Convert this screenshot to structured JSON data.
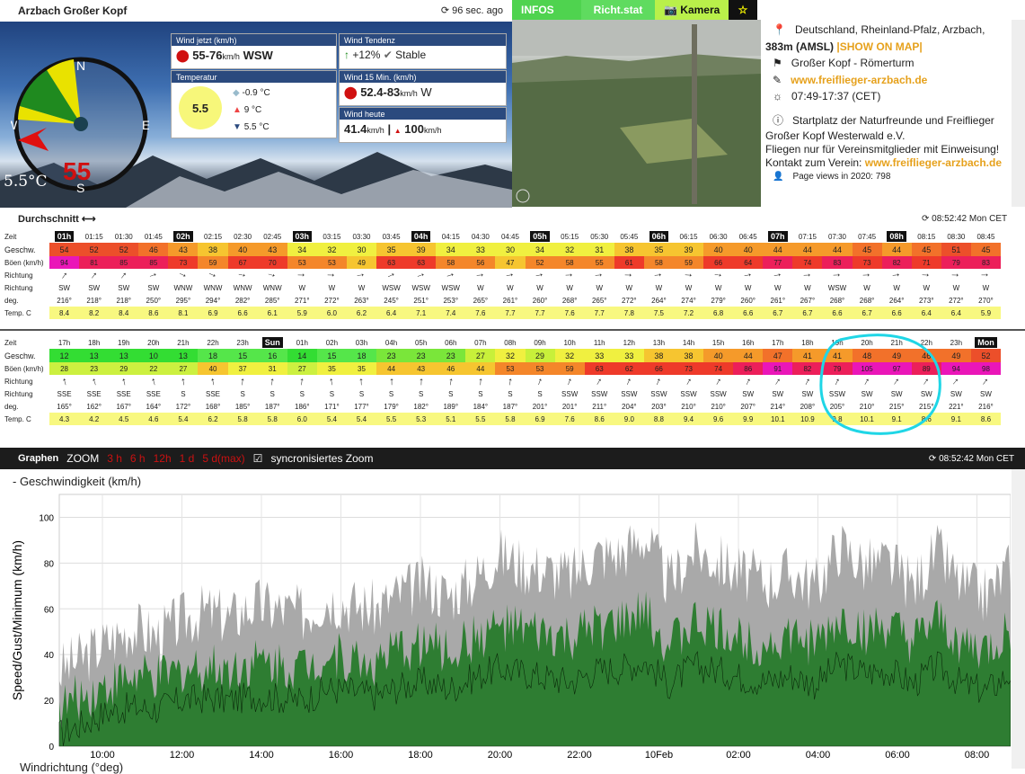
{
  "station": {
    "title": "Arzbach Großer Kopf",
    "updated": "96 sec. ago"
  },
  "tabs": [
    "INFOS",
    "Richt.stat",
    "Kamera"
  ],
  "compass": {
    "speed": "55",
    "temp": "5.5°C",
    "N": "N",
    "S": "S",
    "E": "E",
    "W": "W"
  },
  "cards": {
    "wind_now": {
      "title": "Wind jetzt (km/h)",
      "range": "55-76",
      "unit": "km/h",
      "dir": "WSW"
    },
    "trend": {
      "title": "Wind Tendenz",
      "delta": "+12%",
      "state": "Stable"
    },
    "temp": {
      "title": "Temperatur",
      "value": "5.5",
      "min": "-0.9 °C",
      "max": "9 °C",
      "cur": "5.5 °C"
    },
    "wind15": {
      "title": "Wind 15 Min. (km/h)",
      "range": "52.4-83",
      "unit": "km/h",
      "dir": "W"
    },
    "today": {
      "title": "Wind heute",
      "avg": "41.4",
      "unit": "km/h",
      "max": "100",
      "max_unit": "km/h"
    }
  },
  "info": {
    "location": "Deutschland, Rheinland-Pfalz, Arzbach,",
    "altitude": "383m (AMSL)",
    "map_link": "|SHOW ON MAP|",
    "name": "Großer Kopf - Römerturm",
    "website": "www.freiflieger-arzbach.de",
    "hours": "07:49-17:37 (CET)",
    "desc1": "Startplatz der Naturfreunde und Freiflieger",
    "desc2": "Großer Kopf Westerwald e.V.",
    "desc3": "Fliegen nur für Vereinsmitglieder mit Einweisung!",
    "contact": "Kontakt zum Verein:",
    "contact_link": "www.freiflieger-arzbach.de",
    "views": "Page views in 2020: 798"
  },
  "avg": {
    "title": "Durchschnitt",
    "time": "08:52:42 Mon CET"
  },
  "table1": {
    "times": [
      "01h",
      "01:15",
      "01:30",
      "01:45",
      "02h",
      "02:15",
      "02:30",
      "02:45",
      "03h",
      "03:15",
      "03:30",
      "03:45",
      "04h",
      "04:15",
      "04:30",
      "04:45",
      "05h",
      "05:15",
      "05:30",
      "05:45",
      "06h",
      "06:15",
      "06:30",
      "06:45",
      "07h",
      "07:15",
      "07:30",
      "07:45",
      "08h",
      "08:15",
      "08:30",
      "08:45"
    ],
    "speed": [
      54,
      52,
      52,
      46,
      43,
      38,
      40,
      43,
      34,
      32,
      30,
      35,
      39,
      34,
      33,
      30,
      34,
      32,
      31,
      38,
      35,
      39,
      40,
      40,
      44,
      44,
      44,
      45,
      44,
      45,
      51,
      45
    ],
    "gust": [
      94,
      81,
      85,
      85,
      73,
      59,
      67,
      70,
      53,
      53,
      49,
      63,
      63,
      58,
      56,
      47,
      52,
      58,
      55,
      61,
      58,
      59,
      66,
      64,
      77,
      74,
      83,
      73,
      82,
      71,
      79,
      83
    ],
    "dir": [
      "SW",
      "SW",
      "SW",
      "SW",
      "WNW",
      "WNW",
      "WNW",
      "WNW",
      "W",
      "W",
      "W",
      "WSW",
      "WSW",
      "WSW",
      "W",
      "W",
      "W",
      "W",
      "W",
      "W",
      "W",
      "W",
      "W",
      "W",
      "W",
      "W",
      "WSW",
      "W",
      "W",
      "W",
      "W",
      "W"
    ],
    "deg": [
      "216°",
      "218°",
      "218°",
      "250°",
      "295°",
      "294°",
      "282°",
      "285°",
      "271°",
      "272°",
      "263°",
      "245°",
      "251°",
      "253°",
      "265°",
      "261°",
      "260°",
      "268°",
      "265°",
      "272°",
      "264°",
      "274°",
      "279°",
      "260°",
      "261°",
      "267°",
      "268°",
      "268°",
      "264°",
      "273°",
      "272°",
      "270°"
    ],
    "temp": [
      "8.4",
      "8.2",
      "8.4",
      "8.6",
      "8.1",
      "6.9",
      "6.6",
      "6.1",
      "5.9",
      "6.0",
      "6.2",
      "6.4",
      "7.1",
      "7.4",
      "7.6",
      "7.7",
      "7.7",
      "7.6",
      "7.7",
      "7.8",
      "7.5",
      "7.2",
      "6.8",
      "6.6",
      "6.7",
      "6.7",
      "6.6",
      "6.7",
      "6.6",
      "6.4",
      "6.4",
      "5.9"
    ]
  },
  "table2": {
    "times": [
      "17h",
      "18h",
      "19h",
      "20h",
      "21h",
      "22h",
      "23h",
      "Sun",
      "01h",
      "02h",
      "03h",
      "04h",
      "05h",
      "06h",
      "07h",
      "08h",
      "09h",
      "10h",
      "11h",
      "12h",
      "13h",
      "14h",
      "15h",
      "16h",
      "17h",
      "18h",
      "19h",
      "20h",
      "21h",
      "22h",
      "23h",
      "Mon"
    ],
    "speed": [
      12,
      13,
      13,
      10,
      13,
      18,
      15,
      16,
      14,
      15,
      18,
      23,
      23,
      23,
      27,
      32,
      29,
      32,
      33,
      33,
      38,
      38,
      40,
      44,
      47,
      41,
      41,
      48,
      49,
      46,
      49,
      52
    ],
    "gust": [
      28,
      23,
      29,
      22,
      27,
      40,
      37,
      31,
      27,
      35,
      35,
      44,
      43,
      46,
      44,
      53,
      53,
      59,
      63,
      62,
      66,
      73,
      74,
      86,
      91,
      82,
      79,
      105,
      97,
      89,
      94,
      98
    ],
    "dir": [
      "SSE",
      "SSE",
      "SSE",
      "SSE",
      "S",
      "SSE",
      "S",
      "S",
      "S",
      "S",
      "S",
      "S",
      "S",
      "S",
      "S",
      "S",
      "S",
      "SSW",
      "SSW",
      "SSW",
      "SSW",
      "SSW",
      "SSW",
      "SW",
      "SW",
      "SW",
      "SSW",
      "SW",
      "SW",
      "SW",
      "SW",
      "SW"
    ],
    "deg": [
      "165°",
      "162°",
      "167°",
      "164°",
      "172°",
      "168°",
      "185°",
      "187°",
      "186°",
      "171°",
      "177°",
      "179°",
      "182°",
      "189°",
      "184°",
      "187°",
      "201°",
      "201°",
      "211°",
      "204°",
      "203°",
      "210°",
      "210°",
      "207°",
      "214°",
      "208°",
      "205°",
      "210°",
      "215°",
      "215°",
      "221°",
      "216°"
    ],
    "temp": [
      "4.3",
      "4.2",
      "4.5",
      "4.6",
      "5.4",
      "6.2",
      "5.8",
      "5.8",
      "6.0",
      "5.4",
      "5.4",
      "5.5",
      "5.3",
      "5.1",
      "5.5",
      "5.8",
      "6.9",
      "7.6",
      "8.6",
      "9.0",
      "8.8",
      "9.4",
      "9.6",
      "9.9",
      "10.1",
      "10.9",
      "9.8",
      "10.1",
      "9.1",
      "8.6",
      "9.1",
      "8.6"
    ]
  },
  "labels": {
    "zeit": "Zeit",
    "geschw": "Geschw.",
    "boen": "Böen (km/h)",
    "richtung": "Richtung",
    "richtung2": "Richtung",
    "deg": "deg.",
    "temp": "Temp. C"
  },
  "graph": {
    "title": "Graphen",
    "zoom": "ZOOM",
    "zooms": [
      "3 h",
      "6 h",
      "12h",
      "1 d",
      "5 d(max)"
    ],
    "sync": "syncronisiertes Zoom",
    "time": "08:52:42 Mon CET"
  },
  "chart_data": {
    "type": "area",
    "title": "- Geschwindigkeit (km/h)",
    "ylabel": "Speed/Gust/Minimum (km/h)",
    "ylim": [
      0,
      110
    ],
    "yticks": [
      0,
      20,
      40,
      60,
      80,
      100
    ],
    "xticks": [
      "10:00",
      "12:00",
      "14:00",
      "16:00",
      "18:00",
      "20:00",
      "22:00",
      "10Feb",
      "02:00",
      "04:00",
      "06:00",
      "08:00"
    ],
    "series": [
      {
        "name": "Gust",
        "color": "#a9a9a9",
        "values": [
          33,
          39,
          46,
          52,
          48,
          55,
          59,
          56,
          62,
          60,
          58,
          65,
          62,
          60,
          67,
          71,
          66,
          73,
          84,
          79,
          77,
          74,
          84,
          84,
          92,
          71,
          86,
          81,
          75,
          72,
          76,
          70,
          88,
          79,
          80,
          70,
          85,
          70,
          66,
          79
        ]
      },
      {
        "name": "Speed",
        "color": "#2e7d32",
        "values": [
          17,
          22,
          27,
          30,
          29,
          33,
          35,
          34,
          37,
          36,
          35,
          40,
          38,
          36,
          42,
          45,
          41,
          47,
          52,
          50,
          48,
          46,
          52,
          53,
          58,
          44,
          54,
          51,
          47,
          45,
          48,
          44,
          55,
          50,
          51,
          44,
          54,
          44,
          41,
          50
        ]
      },
      {
        "name": "Minimum",
        "color": "#0d3d0d",
        "values": [
          5,
          10,
          15,
          17,
          16,
          20,
          21,
          20,
          22,
          21,
          20,
          25,
          24,
          22,
          26,
          28,
          25,
          30,
          34,
          32,
          30,
          28,
          33,
          34,
          37,
          27,
          35,
          33,
          30,
          28,
          31,
          27,
          36,
          32,
          33,
          27,
          35,
          27,
          24,
          32
        ]
      }
    ]
  },
  "next_section": "Windrichtung (°deg)"
}
